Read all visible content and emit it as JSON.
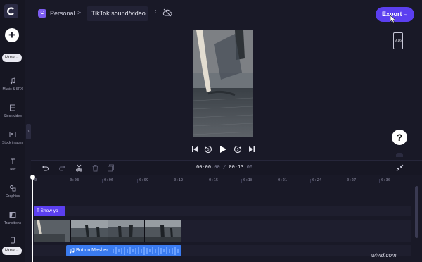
{
  "app": {
    "logo_letter": "C"
  },
  "sidebar": {
    "more_top": "More",
    "more_bottom": "More",
    "items": [
      {
        "label": "Music & SFX",
        "icon": "music-icon"
      },
      {
        "label": "Stock video",
        "icon": "film-icon"
      },
      {
        "label": "Stock images",
        "icon": "image-icon"
      },
      {
        "label": "Text",
        "icon": "text-icon"
      },
      {
        "label": "Graphics",
        "icon": "shapes-icon"
      },
      {
        "label": "Transitions",
        "icon": "transitions-icon"
      }
    ]
  },
  "header": {
    "project_badge": "C",
    "project_name": "Personal",
    "breadcrumb_separator": ">",
    "video_title": "TikTok sound/video",
    "export_label": "Export"
  },
  "preview": {
    "aspect_ratio": "9:16"
  },
  "timeline": {
    "current_time": "00:00.",
    "current_frac": "00",
    "separator": " / ",
    "total_time": "00:13.",
    "total_frac": "00",
    "ruler_ticks": [
      "0",
      "0:03",
      "0:06",
      "0:09",
      "0:12",
      "0:15",
      "0:18",
      "0:21",
      "0:24",
      "0:27",
      "0:30"
    ],
    "text_clip_label": "Show yo",
    "audio_clip_label": "Button Masher"
  },
  "watermark": "wtvid.com",
  "colors": {
    "accent": "#5b3ff0",
    "audio": "#3a7bf0",
    "background": "#191927"
  }
}
